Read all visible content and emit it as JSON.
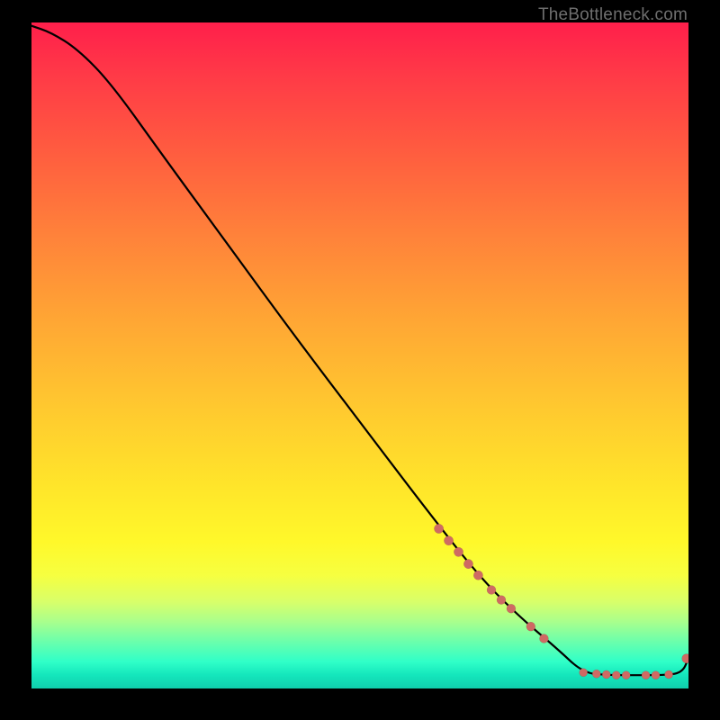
{
  "watermark": "TheBottleneck.com",
  "colors": {
    "background": "#000000",
    "curve": "#000000",
    "dot": "#cf6a63"
  },
  "chart_data": {
    "type": "line",
    "title": "",
    "xlabel": "",
    "ylabel": "",
    "xlim": [
      0,
      100
    ],
    "ylim": [
      0,
      100
    ],
    "legend": false,
    "grid": false,
    "note": "Values are read in percent of the plot area (0–100 on both axes). The curve starts near the top-left, descends roughly linearly, flattens near the bottom around x≈84, and stays near y≈2 with a small uptick at the far right. Dots mark sampled points along the lower-right portion of the curve.",
    "series": [
      {
        "name": "curve",
        "x": [
          0,
          3,
          7,
          12,
          20,
          30,
          40,
          50,
          60,
          68,
          74,
          80,
          84,
          88,
          92,
          96,
          99,
          100
        ],
        "values": [
          99.5,
          98.5,
          96,
          91,
          80,
          66.5,
          53,
          40,
          27,
          17,
          11,
          6,
          2.3,
          2.0,
          2.0,
          2.0,
          2.3,
          4.5
        ]
      }
    ],
    "dots": {
      "name": "samples",
      "x": [
        62,
        63.5,
        65,
        66.5,
        68,
        70,
        71.5,
        73,
        76,
        78,
        84,
        86,
        87.5,
        89,
        90.5,
        93.5,
        95,
        97,
        99.7
      ],
      "values": [
        24,
        22.2,
        20.5,
        18.7,
        17,
        14.8,
        13.3,
        12,
        9.3,
        7.5,
        2.4,
        2.2,
        2.1,
        2.0,
        2.0,
        2.0,
        2.0,
        2.1,
        4.5
      ],
      "r": [
        5.2,
        5.2,
        5.2,
        5.2,
        5.2,
        5.0,
        5.0,
        5.0,
        5.0,
        5.0,
        4.6,
        4.6,
        4.6,
        4.6,
        4.6,
        4.6,
        4.6,
        4.6,
        5.2
      ]
    }
  }
}
